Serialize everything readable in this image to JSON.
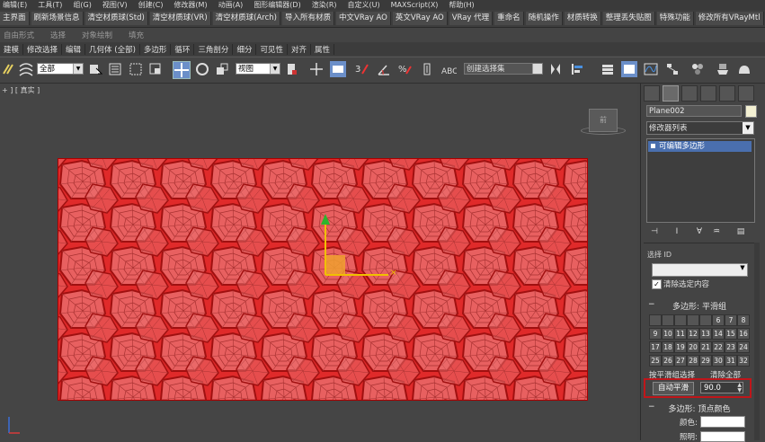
{
  "menu": [
    "编辑(E)",
    "工具(T)",
    "组(G)",
    "视图(V)",
    "创建(C)",
    "修改器(M)",
    "动画(A)",
    "图形编辑器(D)",
    "渲染(R)",
    "自定义(U)",
    "MAXScript(X)",
    "帮助(H)"
  ],
  "script_toolbar": [
    "主界面",
    "刷新场景信息",
    "清空材质球(Std)",
    "清空材质球(VR)",
    "清空材质球(Arch)",
    "导入所有材质",
    "中文VRay AO",
    "英文VRay AO",
    "VRay 代理",
    "重命名",
    "随机操作",
    "材质转换",
    "整理丢失贴图",
    "特殊功能",
    "修改所有VRayMtl"
  ],
  "ribbon_tabs": [
    "自由形式",
    "选择",
    "对象绘制",
    "填充"
  ],
  "ribbon_sub": [
    "建模",
    "修改选择",
    "编辑",
    "几何体 (全部)",
    "多边形",
    "循环",
    "三角剖分",
    "细分",
    "可见性",
    "对齐",
    "属性"
  ],
  "toolbar": {
    "selection_filter": "全部",
    "reference_coord": "视图",
    "named_selection": "创建选择集"
  },
  "viewport": {
    "label": "+ ] [ 真实 ]",
    "viewcube_face": "前"
  },
  "command_panel": {
    "object_name": "Plane002",
    "modifier_list": "修改器列表",
    "stack_item": "可编辑多边形",
    "rollout_select_label": "选择 ID",
    "clear_selection_label": "清除选定内容",
    "smoothing_title": "多边形: 平滑组",
    "smoothing_groups": [
      [
        "",
        "",
        "",
        "",
        "",
        "6",
        "7",
        "8"
      ],
      [
        "9",
        "10",
        "11",
        "12",
        "13",
        "14",
        "15",
        "16"
      ],
      [
        "17",
        "18",
        "19",
        "20",
        "21",
        "22",
        "23",
        "24"
      ],
      [
        "25",
        "26",
        "27",
        "28",
        "29",
        "30",
        "31",
        "32"
      ]
    ],
    "select_by_sg": "按平滑组选择",
    "clear_all": "清除全部",
    "auto_smooth": "自动平滑",
    "threshold": "90.0",
    "vertex_color_title": "多边形: 顶点颜色",
    "color_label": "颜色:",
    "illum_label": "照明:"
  },
  "colors": {
    "plane": "#e02a2a",
    "highlight_box": "#c0161a",
    "stack_selected": "#4a6fae"
  }
}
